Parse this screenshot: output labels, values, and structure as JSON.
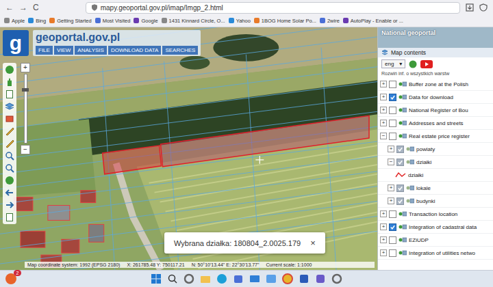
{
  "browser": {
    "nav": [
      "←",
      "→",
      "C"
    ],
    "address": "mapy.geoportal.gov.pl/imap/Imgp_2.html",
    "bookmarks": [
      "Apple",
      "Bing",
      "Getting Started",
      "Most Visited",
      "Google",
      "1431 Kinnard Circle, O...",
      "Yahoo",
      "1BOG Home Solar Po...",
      "2wire",
      "AutoPlay - Enable or ..."
    ]
  },
  "app": {
    "logo": "g",
    "title": "geoportal.gov.pl",
    "menu": [
      "FILE",
      "VIEW",
      "ANALYSIS",
      "DOWNLOAD DATA",
      "SEARCHES"
    ],
    "zoom": [
      "+",
      "−"
    ]
  },
  "map": {
    "selection_popup": {
      "text": "Wybrana działka: 180804_2.0025.179",
      "close": "×"
    },
    "status_bar": [
      "Map coordinate system: 1992 (EPSG 2180)",
      "X: 261785.48 Y: 750117.21",
      "N: 50°10'13.44\" E: 22°30'13.77\"",
      "Current scale: 1:1000"
    ]
  },
  "panel": {
    "title": "National geoportal",
    "subtitle": "Map contents",
    "language": {
      "value": "eng",
      "arrow": "▾"
    },
    "expand_all": "Rozwiń inf. o wszystkich warstw",
    "layers": [
      {
        "label": "Buffer zone at the Polish",
        "kind": "group",
        "toggle": "+",
        "expanded": false,
        "checked": false,
        "disabled": false
      },
      {
        "label": "Data for download",
        "kind": "group",
        "toggle": "+",
        "expanded": false,
        "checked": true,
        "disabled": false
      },
      {
        "label": "National Register of Bou",
        "kind": "group",
        "toggle": "+",
        "expanded": false,
        "checked": false,
        "disabled": false
      },
      {
        "label": "Addresses and streets",
        "kind": "group",
        "toggle": "+",
        "expanded": false,
        "checked": false,
        "disabled": false
      },
      {
        "label": "Real estate price register",
        "kind": "group",
        "toggle": "−",
        "expanded": true,
        "checked": false,
        "disabled": false,
        "children": [
          {
            "label": "powiaty",
            "kind": "group",
            "toggle": "+",
            "expanded": false,
            "checked": true,
            "disabled": true
          },
          {
            "label": "działki",
            "kind": "group",
            "toggle": "−",
            "expanded": true,
            "checked": true,
            "disabled": true,
            "children": [
              {
                "label": "działki",
                "kind": "line"
              }
            ]
          },
          {
            "label": "lokale",
            "kind": "group",
            "toggle": "+",
            "expanded": false,
            "checked": true,
            "disabled": true
          },
          {
            "label": "budynki",
            "kind": "group",
            "toggle": "+",
            "expanded": false,
            "checked": true,
            "disabled": true
          }
        ]
      },
      {
        "label": "Transaction location",
        "kind": "group",
        "toggle": "+",
        "expanded": false,
        "checked": false,
        "disabled": false
      },
      {
        "label": "Integration of cadastral data",
        "kind": "group",
        "toggle": "+",
        "expanded": false,
        "checked": true,
        "disabled": false
      },
      {
        "label": "EZiUDP",
        "kind": "group",
        "toggle": "+",
        "expanded": false,
        "checked": false,
        "disabled": false
      },
      {
        "label": "Integration of utilities netwo",
        "kind": "group",
        "toggle": "+",
        "expanded": false,
        "checked": false,
        "disabled": false
      }
    ]
  },
  "taskbar": {
    "badge": "2"
  }
}
